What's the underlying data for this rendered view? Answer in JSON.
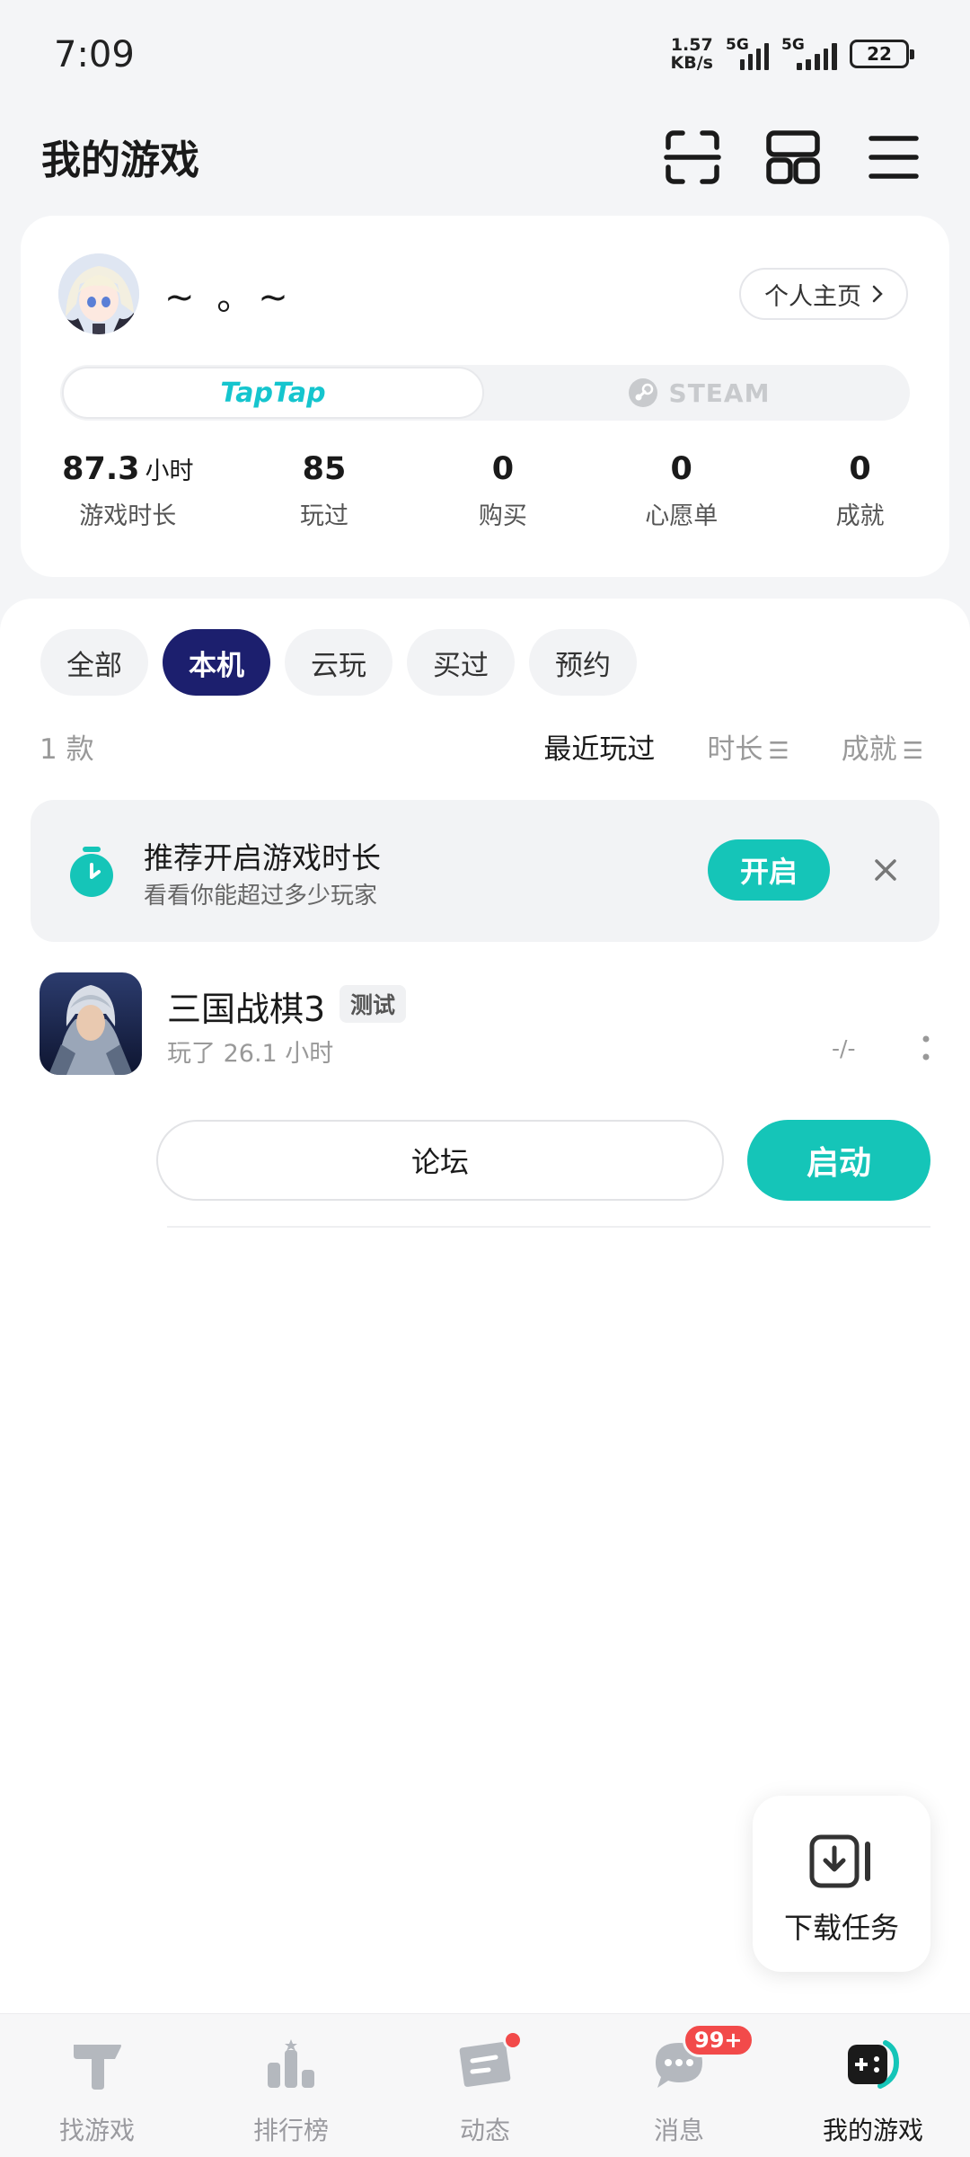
{
  "status_bar": {
    "time": "7:09",
    "net_speed_value": "1.57",
    "net_speed_unit": "KB/s",
    "signal1_tag": "5G",
    "signal2_tag": "5G",
    "battery": "22"
  },
  "header": {
    "title": "我的游戏",
    "icons": [
      "scan-icon",
      "apps-grid-icon",
      "menu-icon"
    ]
  },
  "profile": {
    "username": "~ 。~",
    "homepage_label": "个人主页",
    "platforms": {
      "taptap": "TapTap",
      "steam": "STEAM",
      "active": "taptap"
    },
    "stats": [
      {
        "value": "87.3",
        "unit": "小时",
        "label": "游戏时长"
      },
      {
        "value": "85",
        "unit": "",
        "label": "玩过"
      },
      {
        "value": "0",
        "unit": "",
        "label": "购买"
      },
      {
        "value": "0",
        "unit": "",
        "label": "心愿单"
      },
      {
        "value": "0",
        "unit": "",
        "label": "成就"
      }
    ]
  },
  "filters": {
    "tabs": [
      "全部",
      "本机",
      "云玩",
      "买过",
      "预约"
    ],
    "active": "本机"
  },
  "list": {
    "count": "1 款",
    "sort_options": [
      "最近玩过",
      "时长",
      "成就"
    ],
    "active_sort": "最近玩过"
  },
  "recommend": {
    "title": "推荐开启游戏时长",
    "subtitle": "看看你能超过多少玩家",
    "button": "开启"
  },
  "games": [
    {
      "name": "三国战棋3",
      "badge": "测试",
      "playtime": "玩了 26.1 小时",
      "rating": "-/-",
      "forum_label": "论坛",
      "launch_label": "启动"
    }
  ],
  "download_fab": {
    "label": "下载任务"
  },
  "bottom_nav": {
    "items": [
      {
        "label": "找游戏",
        "icon": "find-games-icon"
      },
      {
        "label": "排行榜",
        "icon": "ranking-icon"
      },
      {
        "label": "动态",
        "icon": "feed-icon"
      },
      {
        "label": "消息",
        "icon": "message-icon",
        "badge": "99+"
      },
      {
        "label": "我的游戏",
        "icon": "my-games-icon"
      }
    ],
    "active": "我的游戏"
  },
  "colors": {
    "accent": "#15c5b8",
    "active_tab": "#1c1f6e",
    "badge_red": "#f24a4a"
  }
}
